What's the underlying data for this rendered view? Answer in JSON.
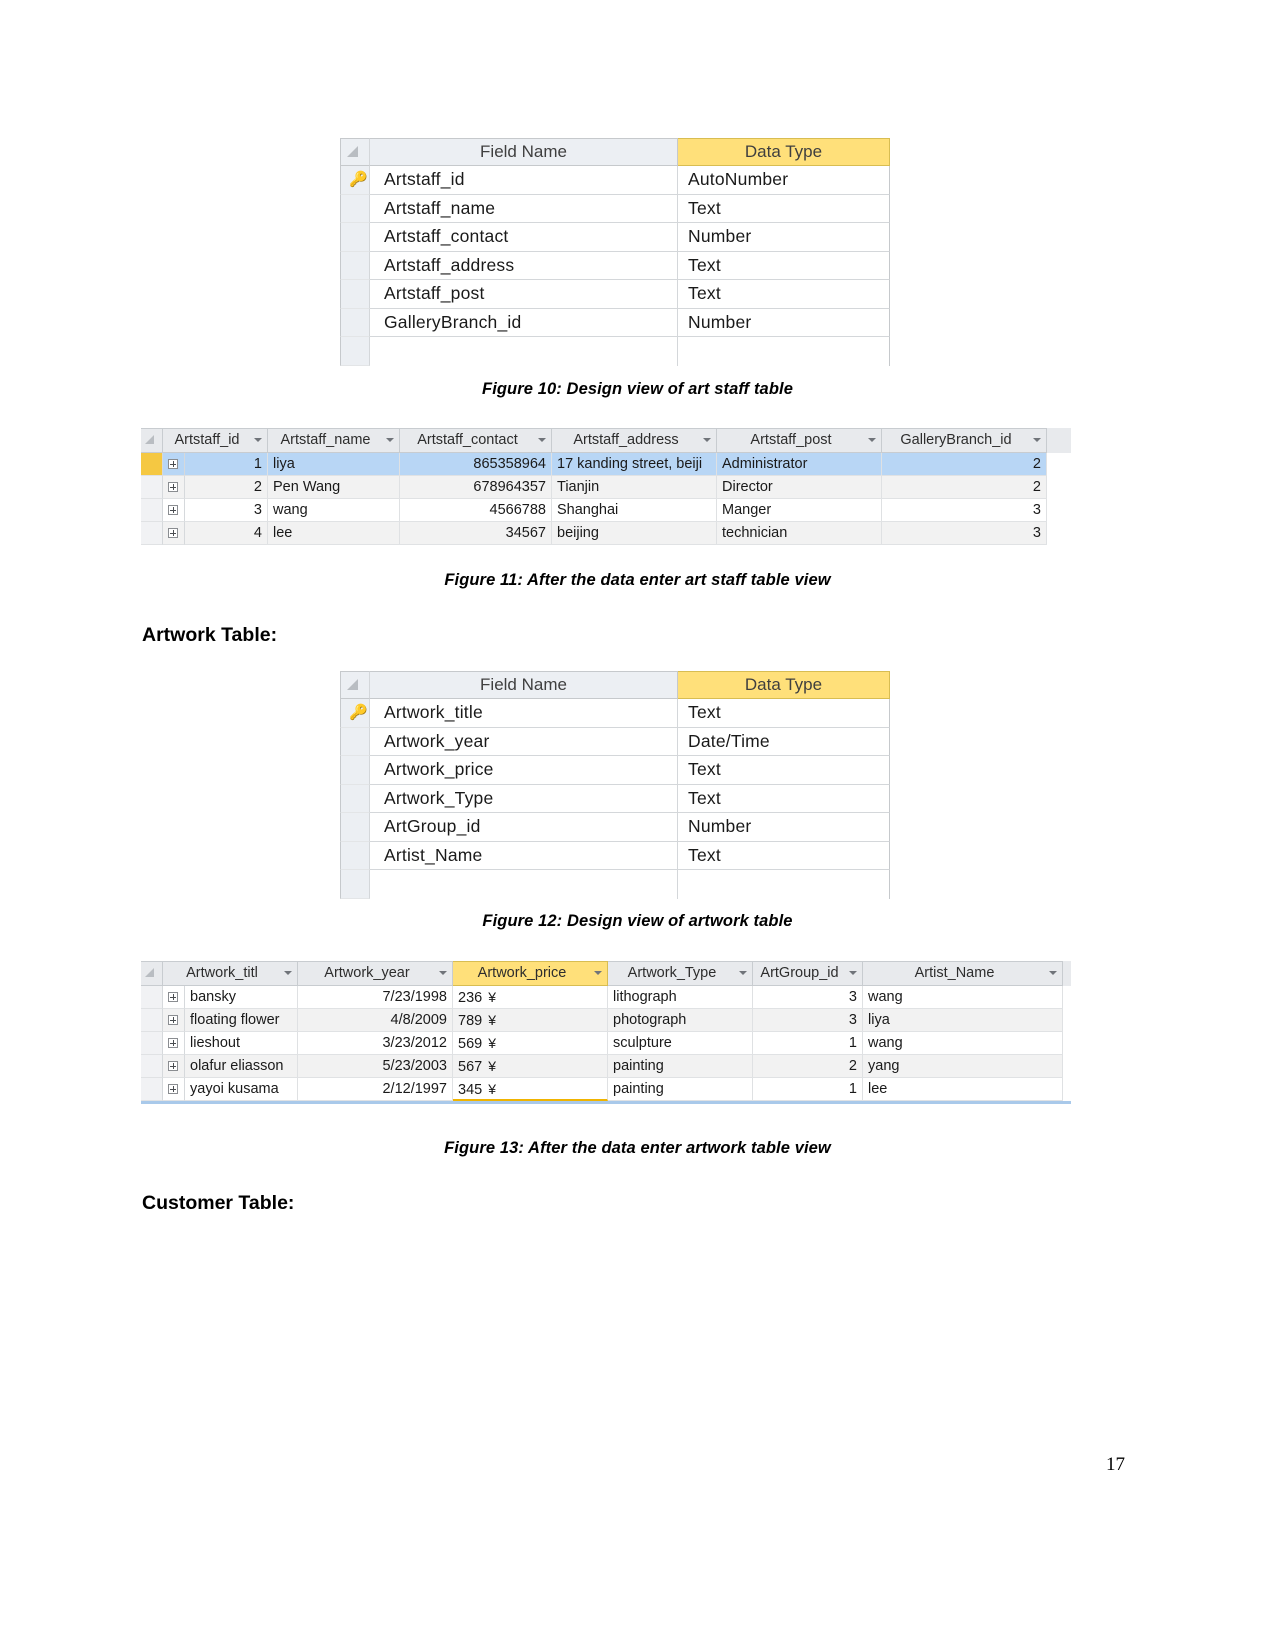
{
  "page": {
    "number": "17"
  },
  "headings": {
    "artwork_table": "Artwork Table:",
    "customer_table": "Customer Table:"
  },
  "captions": {
    "fig10": "Figure 10: Design view of art staff table",
    "fig11": "Figure 11: After the data enter art staff table view",
    "fig12": "Figure 12: Design view of artwork table",
    "fig13": "Figure 13: After the data enter artwork table view"
  },
  "colors": {
    "header_yellow": "#ffe07a",
    "header_grey": "#e8eaed",
    "selected_row_blue": "#b8d6f5",
    "row_selector_active": "#f5c842",
    "key_icon": "#b6a22c"
  },
  "artstaff_design": {
    "columns": [
      "Field Name",
      "Data Type"
    ],
    "rows": [
      {
        "primary_key": true,
        "field": "Artstaff_id",
        "type": "AutoNumber"
      },
      {
        "primary_key": false,
        "field": "Artstaff_name",
        "type": "Text"
      },
      {
        "primary_key": false,
        "field": "Artstaff_contact",
        "type": "Number"
      },
      {
        "primary_key": false,
        "field": "Artstaff_address",
        "type": "Text"
      },
      {
        "primary_key": false,
        "field": "Artstaff_post",
        "type": "Text"
      },
      {
        "primary_key": false,
        "field": "GalleryBranch_id",
        "type": "Number"
      },
      {
        "primary_key": false,
        "field": "",
        "type": ""
      }
    ]
  },
  "artstaff_data": {
    "columns": [
      "Artstaff_id",
      "Artstaff_name",
      "Artstaff_contact",
      "Artstaff_address",
      "Artstaff_post",
      "GalleryBranch_id"
    ],
    "rows": [
      {
        "selected": true,
        "Artstaff_id": "1",
        "Artstaff_name": "liya",
        "Artstaff_contact": "865358964",
        "Artstaff_address": "17 kanding street, beiji",
        "Artstaff_post": "Administrator",
        "GalleryBranch_id": "2"
      },
      {
        "selected": false,
        "Artstaff_id": "2",
        "Artstaff_name": "Pen Wang",
        "Artstaff_contact": "678964357",
        "Artstaff_address": "Tianjin",
        "Artstaff_post": "Director",
        "GalleryBranch_id": "2"
      },
      {
        "selected": false,
        "Artstaff_id": "3",
        "Artstaff_name": "wang",
        "Artstaff_contact": "4566788",
        "Artstaff_address": "Shanghai",
        "Artstaff_post": "Manger",
        "GalleryBranch_id": "3"
      },
      {
        "selected": false,
        "Artstaff_id": "4",
        "Artstaff_name": "lee",
        "Artstaff_contact": "34567",
        "Artstaff_address": "beijing",
        "Artstaff_post": "technician",
        "GalleryBranch_id": "3"
      }
    ]
  },
  "artwork_design": {
    "columns": [
      "Field Name",
      "Data Type"
    ],
    "rows": [
      {
        "primary_key": true,
        "field": "Artwork_title",
        "type": "Text"
      },
      {
        "primary_key": false,
        "field": "Artwork_year",
        "type": "Date/Time"
      },
      {
        "primary_key": false,
        "field": "Artwork_price",
        "type": "Text"
      },
      {
        "primary_key": false,
        "field": "Artwork_Type",
        "type": "Text"
      },
      {
        "primary_key": false,
        "field": "ArtGroup_id",
        "type": "Number"
      },
      {
        "primary_key": false,
        "field": "Artist_Name",
        "type": "Text"
      },
      {
        "primary_key": false,
        "field": "",
        "type": ""
      }
    ]
  },
  "artwork_data": {
    "columns": [
      "Artwork_titl",
      "Artwork_year",
      "Artwork_price",
      "Artwork_Type",
      "ArtGroup_id",
      "Artist_Name"
    ],
    "selected_column": "Artwork_price",
    "currency_symbol": "¥",
    "rows": [
      {
        "Artwork_titl": "bansky",
        "Artwork_year": "7/23/1998",
        "Artwork_price": "236",
        "Artwork_Type": "lithograph",
        "ArtGroup_id": "3",
        "Artist_Name": "wang"
      },
      {
        "Artwork_titl": "floating flower",
        "Artwork_year": "4/8/2009",
        "Artwork_price": "789",
        "Artwork_Type": "photograph",
        "ArtGroup_id": "3",
        "Artist_Name": "liya"
      },
      {
        "Artwork_titl": "lieshout",
        "Artwork_year": "3/23/2012",
        "Artwork_price": "569",
        "Artwork_Type": "sculpture",
        "ArtGroup_id": "1",
        "Artist_Name": "wang"
      },
      {
        "Artwork_titl": "olafur eliasson",
        "Artwork_year": "5/23/2003",
        "Artwork_price": "567",
        "Artwork_Type": "painting",
        "ArtGroup_id": "2",
        "Artist_Name": "yang"
      },
      {
        "Artwork_titl": "yayoi kusama",
        "Artwork_year": "2/12/1997",
        "Artwork_price": "345",
        "Artwork_Type": "painting",
        "ArtGroup_id": "1",
        "Artist_Name": "lee"
      }
    ]
  }
}
